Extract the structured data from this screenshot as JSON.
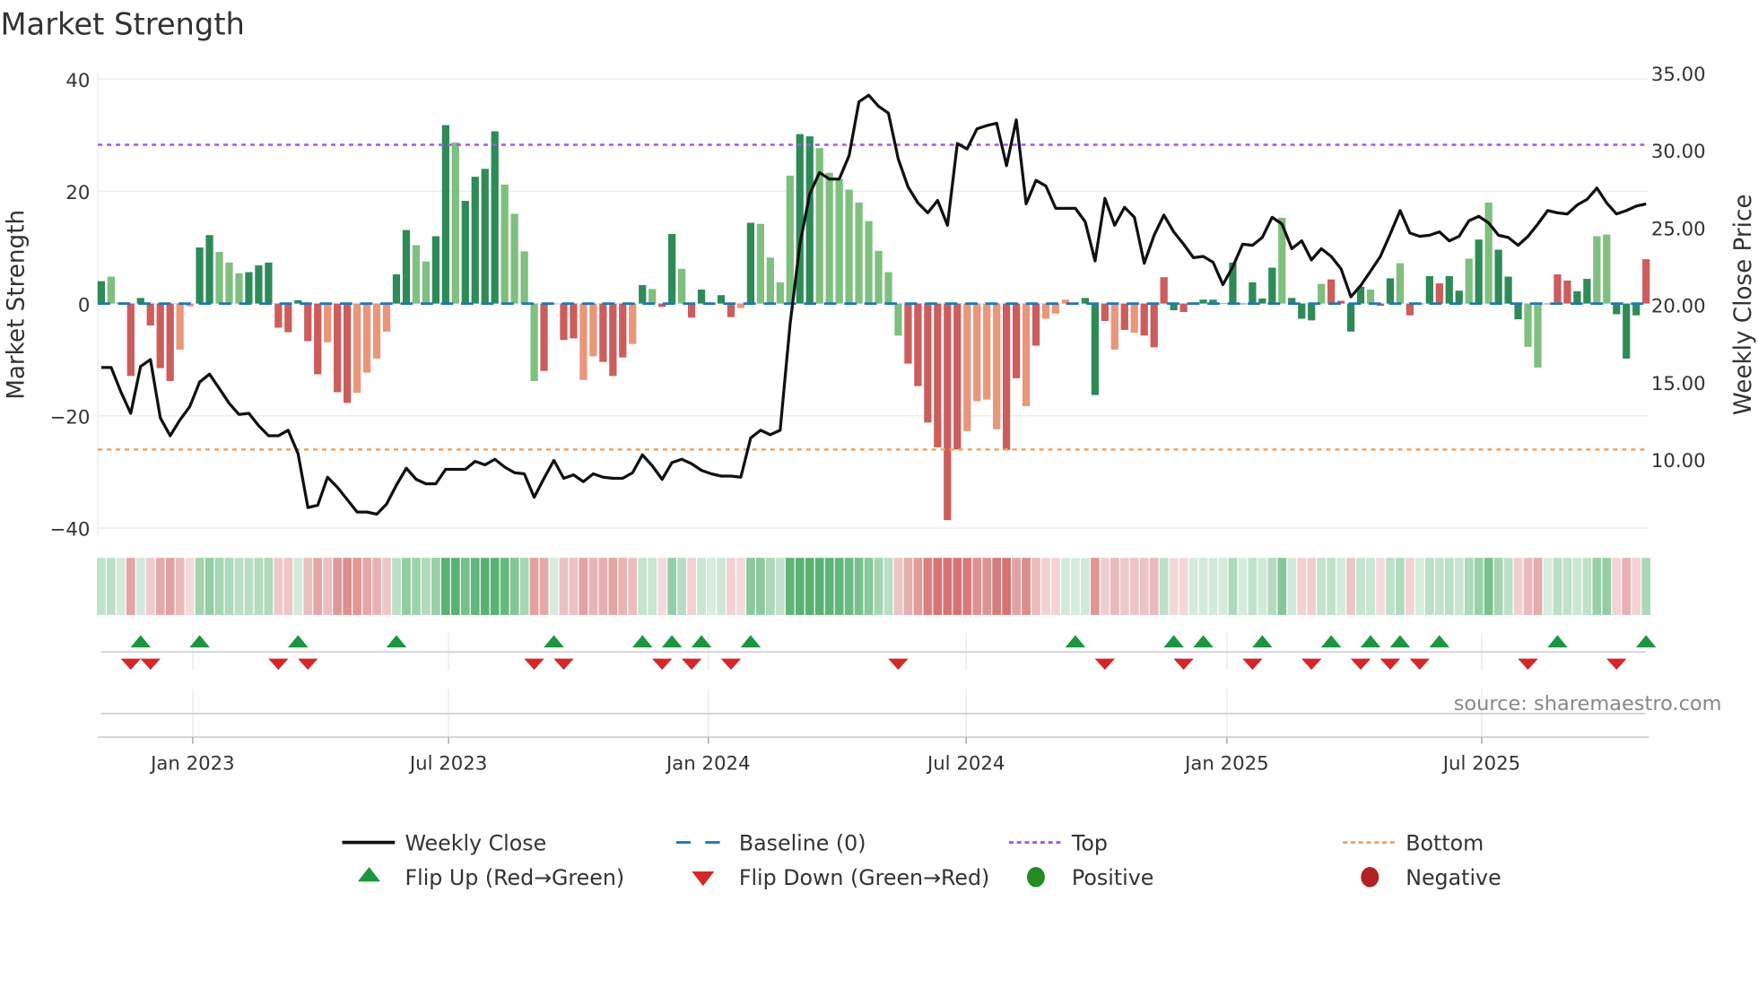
{
  "title": "Market Strength",
  "source": "source: sharemaestro.com",
  "chart_data": {
    "type": "bar",
    "title": "Market Strength",
    "ylabel": "Market Strength",
    "y2label": "Weekly Close Price",
    "ylim": [
      -42,
      40
    ],
    "y2lim": [
      5.4,
      35.0
    ],
    "yticks": [
      {
        "v": 40,
        "label": "40"
      },
      {
        "v": 20,
        "label": "20"
      },
      {
        "v": 0,
        "label": "0"
      },
      {
        "v": -20,
        "label": "−20"
      },
      {
        "v": -40,
        "label": "−40"
      }
    ],
    "y2ticks": [
      {
        "v": 35,
        "label": "35.00"
      },
      {
        "v": 30,
        "label": "30.00"
      },
      {
        "v": 25,
        "label": "25.00"
      },
      {
        "v": 20,
        "label": "20.00"
      },
      {
        "v": 15,
        "label": "15.00"
      },
      {
        "v": 10,
        "label": "10.00"
      }
    ],
    "xticks": [
      {
        "week": 10.3,
        "label": "Jan 2023"
      },
      {
        "week": 36.3,
        "label": "Jul 2023"
      },
      {
        "week": 62.7,
        "label": "Jan 2024"
      },
      {
        "week": 88.9,
        "label": "Jul 2024"
      },
      {
        "week": 115.4,
        "label": "Jan 2025"
      },
      {
        "week": 141.3,
        "label": "Jul 2025"
      }
    ],
    "top_level": 28.3,
    "bottom_level": -26,
    "baseline": 0,
    "strength": [
      4,
      4.8,
      0.2,
      -12.9,
      1,
      -3.9,
      -11.5,
      -13.8,
      -8.2,
      -0.5,
      10,
      12.2,
      9.2,
      7.3,
      5.4,
      5.6,
      6.8,
      7.3,
      -4.3,
      -5.1,
      0.6,
      -6.7,
      -12.6,
      -6.9,
      -15.8,
      -17.7,
      -15.9,
      -12.3,
      -9.8,
      -5,
      5.2,
      13.1,
      10.4,
      7.5,
      12,
      31.8,
      28.7,
      18.3,
      22.6,
      24,
      30.7,
      21.2,
      16,
      9.3,
      -13.8,
      -12,
      0,
      -6.5,
      -6.2,
      -13.6,
      -9.4,
      -10.4,
      -12.9,
      -9.6,
      -7.2,
      3.3,
      2.6,
      -0.6,
      12.4,
      6.2,
      -2.5,
      2.5,
      0,
      1.5,
      -2.4,
      -0.8,
      14.4,
      14.2,
      8.2,
      3.8,
      22.8,
      30.2,
      29.8,
      27.7,
      23.3,
      22.2,
      20.3,
      18,
      14.7,
      9.4,
      5.6,
      -5.7,
      -10.7,
      -14.7,
      -21.2,
      -25.6,
      -38.6,
      -26,
      -22.7,
      -17.4,
      -17.1,
      -22.4,
      -26.1,
      -13.3,
      -18.3,
      -7.5,
      -2.7,
      -1.8,
      0.7,
      0,
      1,
      -16.3,
      -3.1,
      -8.2,
      -4.7,
      -5.2,
      -5.7,
      -7.8,
      4.7,
      -1.2,
      -1.5,
      0.2,
      0.7,
      0.7,
      0.1,
      7.3,
      0,
      3.8,
      0.9,
      6.4,
      15.3,
      1,
      -2.7,
      -3,
      3.5,
      4.3,
      0.5,
      -5,
      3,
      2.5,
      -0.4,
      4.5,
      7.2,
      -2.1,
      0,
      4.9,
      3.6,
      4.9,
      2.3,
      8,
      11.4,
      18,
      9.6,
      4.8,
      -2.8,
      -7.7,
      -11.4,
      0,
      5.2,
      4.1,
      2.2,
      4.4,
      12,
      12.3,
      -1.9,
      -9.8,
      -2.1,
      7.9
    ],
    "bar_class": "GgGRGRRRrrGGgggGGGRRGRRrRRrrrrGGggGGgGGGGggggRrRRrrRRRrGgRGgRGGGRrGggggGGgggggggggRRRRRRrrrrRRrRrrrGGGRrRrRRRGRRGGgGGGGGgGGGgRRGGgRGgRGGRGGgGgGGGggRRRGGggGGGRRrG",
    "weekly_close": [
      15.94,
      15.94,
      14.35,
      12.97,
      16.01,
      16.45,
      12.68,
      11.52,
      12.54,
      13.41,
      15.0,
      15.51,
      14.57,
      13.62,
      12.9,
      12.97,
      12.17,
      11.52,
      11.52,
      11.88,
      10.36,
      6.88,
      7.03,
      8.84,
      8.19,
      7.39,
      6.59,
      6.59,
      6.45,
      7.1,
      8.33,
      9.42,
      8.7,
      8.41,
      8.41,
      9.35,
      9.35,
      9.35,
      9.86,
      9.64,
      10.0,
      9.49,
      9.13,
      9.06,
      7.54,
      8.77,
      9.93,
      8.77,
      8.99,
      8.55,
      9.06,
      8.84,
      8.77,
      8.77,
      9.13,
      10.29,
      9.57,
      8.7,
      9.78,
      10.0,
      9.71,
      9.28,
      9.06,
      8.91,
      8.91,
      8.84,
      11.38,
      11.88,
      11.59,
      11.88,
      18.7,
      23.91,
      27.17,
      28.55,
      28.12,
      28.12,
      29.64,
      33.12,
      33.55,
      32.83,
      32.39,
      29.42,
      27.61,
      26.59,
      25.94,
      26.74,
      25.14,
      30.43,
      30.07,
      31.38,
      31.59,
      31.74,
      28.99,
      31.96,
      26.52,
      28.04,
      27.68,
      26.23,
      26.23,
      26.23,
      25.36,
      22.83,
      26.88,
      25.14,
      26.3,
      25.65,
      22.68,
      24.49,
      25.8,
      24.71,
      23.91,
      23.04,
      23.12,
      22.75,
      21.3,
      22.46,
      23.91,
      23.84,
      24.35,
      25.65,
      25.22,
      23.62,
      24.13,
      22.9,
      23.62,
      23.12,
      22.32,
      20.51,
      21.23,
      22.17,
      23.12,
      24.57,
      26.09,
      24.64,
      24.42,
      24.49,
      24.71,
      24.13,
      24.42,
      25.43,
      25.72,
      25.29,
      24.49,
      24.35,
      23.84,
      24.42,
      25.22,
      26.09,
      25.94,
      25.87,
      26.45,
      26.81,
      27.54,
      26.59,
      25.87,
      26.09,
      26.38,
      26.52
    ],
    "flip_up_weeks": [
      5,
      11,
      21,
      31,
      47,
      56,
      59,
      62,
      67,
      100,
      110,
      113,
      119,
      126,
      130,
      133,
      137,
      149,
      158
    ],
    "flip_down_weeks": [
      4,
      6,
      19,
      22,
      45,
      48,
      58,
      61,
      65,
      82,
      103,
      111,
      118,
      124,
      129,
      132,
      135,
      146,
      155
    ],
    "colors": {
      "strong_pos": "#2e8b57",
      "weak_pos": "#7fbf7f",
      "strong_neg": "#cd5c5c",
      "weak_neg": "#e9967a",
      "line": "#111111",
      "baseline": "#1f77b4",
      "top": "#9b5de5",
      "bottom": "#f4a261",
      "flip_up": "#1a9641",
      "flip_down": "#d62728",
      "positive": "#228b22",
      "negative": "#b22222"
    },
    "legend": [
      {
        "key": "line",
        "label": "Weekly Close"
      },
      {
        "key": "baseline",
        "label": "Baseline (0)"
      },
      {
        "key": "top",
        "label": "Top"
      },
      {
        "key": "bottom",
        "label": "Bottom"
      },
      {
        "key": "flip_up",
        "label": "Flip Up (Red→Green)"
      },
      {
        "key": "flip_down",
        "label": "Flip Down (Green→Red)"
      },
      {
        "key": "positive",
        "label": "Positive"
      },
      {
        "key": "negative",
        "label": "Negative"
      }
    ]
  }
}
